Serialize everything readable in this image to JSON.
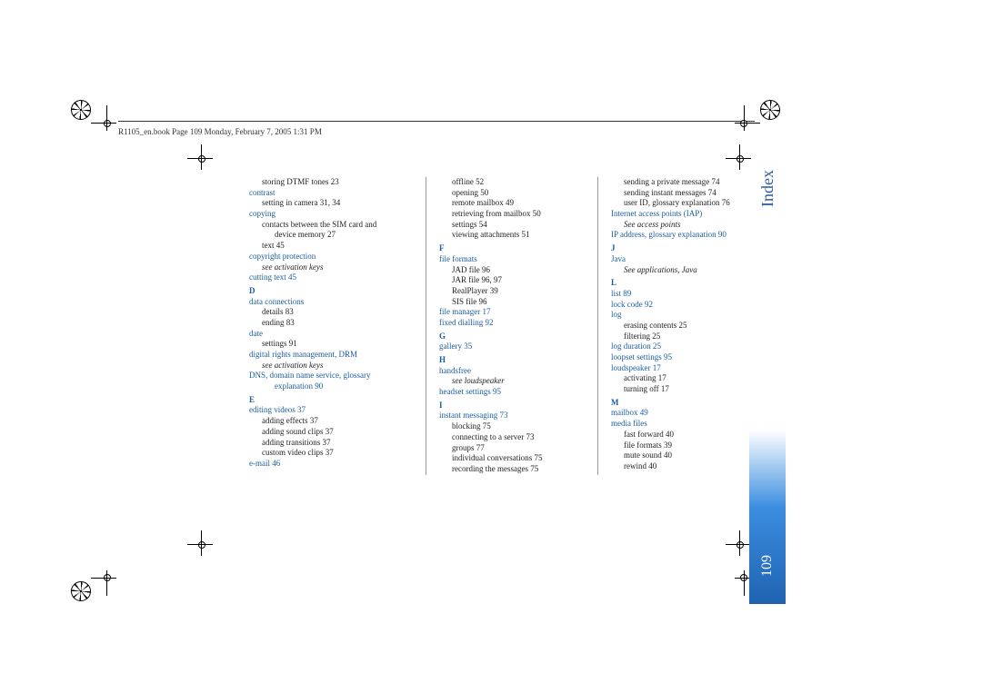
{
  "header": "R1105_en.book  Page 109  Monday, February 7, 2005  1:31 PM",
  "side": {
    "label": "Index",
    "page": "109"
  },
  "col1": [
    {
      "cls": "sub entry",
      "text": "storing DTMF tones  23"
    },
    {
      "cls": "term",
      "text": "contrast"
    },
    {
      "cls": "sub entry",
      "text": "setting in camera  31, 34"
    },
    {
      "cls": "term",
      "text": "copying"
    },
    {
      "cls": "sub entry",
      "text": "contacts between the SIM card and"
    },
    {
      "cls": "sub2 entry",
      "text": "device memory  27"
    },
    {
      "cls": "sub entry",
      "text": "text  45"
    },
    {
      "cls": "term",
      "text": "copyright protection"
    },
    {
      "cls": "sub italic",
      "text": "see activation keys"
    },
    {
      "cls": "term",
      "text": "cutting text  45"
    },
    {
      "cls": "letter",
      "text": "D"
    },
    {
      "cls": "term",
      "text": "data connections"
    },
    {
      "cls": "sub entry",
      "text": "details  83"
    },
    {
      "cls": "sub entry",
      "text": "ending  83"
    },
    {
      "cls": "term",
      "text": "date"
    },
    {
      "cls": "sub entry",
      "text": "settings  91"
    },
    {
      "cls": "term",
      "text": "digital rights management, DRM"
    },
    {
      "cls": "sub italic",
      "text": "see activation keys"
    },
    {
      "cls": "term",
      "text": "DNS, domain name service, glossary"
    },
    {
      "cls": "sub2 term",
      "text": "explanation  90"
    },
    {
      "cls": "letter",
      "text": "E"
    },
    {
      "cls": "term",
      "text": "editing videos  37"
    },
    {
      "cls": "sub entry",
      "text": "adding effects  37"
    },
    {
      "cls": "sub entry",
      "text": "adding sound clips  37"
    },
    {
      "cls": "sub entry",
      "text": "adding transitions  37"
    },
    {
      "cls": "sub entry",
      "text": "custom video clips  37"
    },
    {
      "cls": "term",
      "text": "e-mail  46"
    }
  ],
  "col2": [
    {
      "cls": "sub entry",
      "text": "offline  52"
    },
    {
      "cls": "sub entry",
      "text": "opening  50"
    },
    {
      "cls": "sub entry",
      "text": "remote mailbox  49"
    },
    {
      "cls": "sub entry",
      "text": "retrieving from mailbox  50"
    },
    {
      "cls": "sub entry",
      "text": "settings  54"
    },
    {
      "cls": "sub entry",
      "text": "viewing attachments  51"
    },
    {
      "cls": "letter",
      "text": "F"
    },
    {
      "cls": "term",
      "text": "file formats"
    },
    {
      "cls": "sub entry",
      "text": "JAD file  96"
    },
    {
      "cls": "sub entry",
      "text": "JAR file  96, 97"
    },
    {
      "cls": "sub entry",
      "text": "RealPlayer  39"
    },
    {
      "cls": "sub entry",
      "text": "SIS file  96"
    },
    {
      "cls": "term",
      "text": "file manager  17"
    },
    {
      "cls": "term",
      "text": "fixed dialling  92"
    },
    {
      "cls": "letter",
      "text": "G"
    },
    {
      "cls": "term",
      "text": "gallery  35"
    },
    {
      "cls": "letter",
      "text": "H"
    },
    {
      "cls": "term",
      "text": "handsfree"
    },
    {
      "cls": "sub italic",
      "text": "see loudspeaker"
    },
    {
      "cls": "term",
      "text": "headset settings  95"
    },
    {
      "cls": "letter",
      "text": "I"
    },
    {
      "cls": "term",
      "text": "instant messaging  73"
    },
    {
      "cls": "sub entry",
      "text": "blocking  75"
    },
    {
      "cls": "sub entry",
      "text": "connecting to a server  73"
    },
    {
      "cls": "sub entry",
      "text": "groups  77"
    },
    {
      "cls": "sub entry",
      "text": "individual conversations  75"
    },
    {
      "cls": "sub entry",
      "text": "recording the messages  75"
    }
  ],
  "col3": [
    {
      "cls": "sub entry",
      "text": "sending a private message  74"
    },
    {
      "cls": "sub entry",
      "text": "sending instant messages  74"
    },
    {
      "cls": "sub entry",
      "text": "user ID, glossary explanation  76"
    },
    {
      "cls": "term",
      "text": "Internet access points (IAP)"
    },
    {
      "cls": "sub italic",
      "text": "See access points"
    },
    {
      "cls": "term",
      "text": "IP address, glossary explanation  90"
    },
    {
      "cls": "letter",
      "text": "J"
    },
    {
      "cls": "term",
      "text": "Java"
    },
    {
      "cls": "sub italic",
      "text": "See applications, Java"
    },
    {
      "cls": "letter",
      "text": "L"
    },
    {
      "cls": "term",
      "text": "list  89"
    },
    {
      "cls": "term",
      "text": "lock code  92"
    },
    {
      "cls": "term",
      "text": "log"
    },
    {
      "cls": "sub entry",
      "text": "erasing contents  25"
    },
    {
      "cls": "sub entry",
      "text": "filtering  25"
    },
    {
      "cls": "term",
      "text": "log duration  25"
    },
    {
      "cls": "term",
      "text": "loopset settings  95"
    },
    {
      "cls": "term",
      "text": "loudspeaker  17"
    },
    {
      "cls": "sub entry",
      "text": "activating  17"
    },
    {
      "cls": "sub entry",
      "text": "turning off  17"
    },
    {
      "cls": "letter",
      "text": "M"
    },
    {
      "cls": "term",
      "text": "mailbox  49"
    },
    {
      "cls": "term",
      "text": "media files"
    },
    {
      "cls": "sub entry",
      "text": "fast forward  40"
    },
    {
      "cls": "sub entry",
      "text": "file formats  39"
    },
    {
      "cls": "sub entry",
      "text": "mute sound  40"
    },
    {
      "cls": "sub entry",
      "text": "rewind  40"
    }
  ]
}
